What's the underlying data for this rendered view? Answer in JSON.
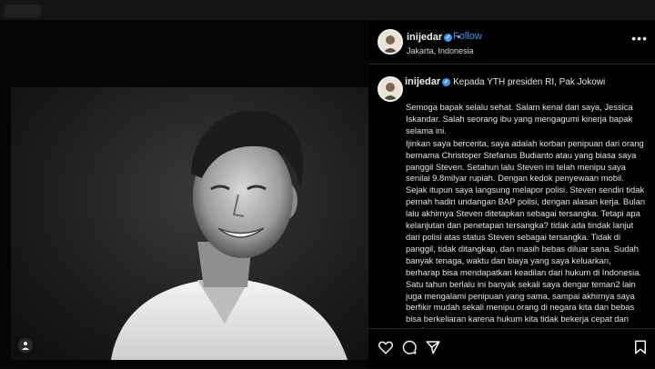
{
  "post": {
    "username": "inijedar",
    "follow_label": "Follow",
    "separator": "•",
    "location": "Jakarta, Indonesia",
    "more_icon": "more-horizontal-icon"
  },
  "caption": {
    "username": "inijedar",
    "title": "Kepada YTH presiden RI, Pak Jokowi",
    "paragraphs": [
      "Semoga bapak selalu sehat. Salam kenal dari saya, Jessica Iskandar. Salah seorang ibu yang mengagumi kinerja bapak selama ini.",
      "Ijinkan saya bercerita, saya adalah korban penipuan dari orang bernama Christoper Stefanus Budianto atau yang biasa saya panggil Steven. Setahun lalu Steven ini telah menipu saya senilai 9.8milyar rupiah. Dengan kedok penyewaan mobil. Sejak itupun saya langsung melapor polisi. Steven sendiri tidak pernah hadiri undangan BAP polisi, dengan alasan kerja. Bulan lalu akhirnya Steven ditetapkan sebagai tersangka. Tetapi apa kelanjutan dari penetapan tersangka? tidak ada tindak lanjut dari polisi atas status Steven sebagai tersangka. Tidak di panggil, tidak ditangkap, dan masih bebas diluar sana. Sudah banyak tenaga, waktu dan biaya yang saya keluarkan, berharap bisa mendapatkan keadilan dari hukum di Indonesia. Satu tahun berlalu ini banyak sekali saya dengar teman2 lain juga mengalami penipuan yang sama, sampai akhirnya saya berfikir mudah sekali menipu orang di negara kita dan bebas bisa berkeliaran karena hukum kita tidak bekerja cepat dan pasti."
    ]
  },
  "icons": {
    "like": "heart-icon",
    "comment": "comment-icon",
    "share": "send-icon",
    "save": "bookmark-icon",
    "tagged": "person-tag-icon"
  },
  "colors": {
    "accent": "#3897f0",
    "background": "#000000"
  }
}
